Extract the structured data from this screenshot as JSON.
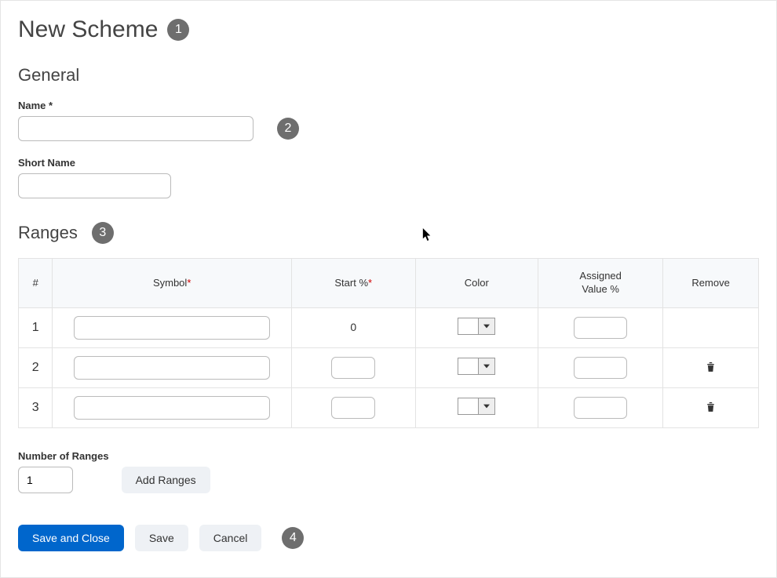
{
  "page_title": "New Scheme",
  "steps": {
    "s1": "1",
    "s2": "2",
    "s3": "3",
    "s4": "4"
  },
  "sections": {
    "general": "General",
    "ranges": "Ranges"
  },
  "fields": {
    "name_label": "Name",
    "name_required": "*",
    "name_value": "",
    "short_name_label": "Short Name",
    "short_name_value": "",
    "num_ranges_label": "Number of Ranges",
    "num_ranges_value": "1"
  },
  "table": {
    "headers": {
      "num": "#",
      "symbol": "Symbol",
      "start": "Start %",
      "color": "Color",
      "assigned": "Assigned\nValue %",
      "remove": "Remove"
    },
    "rows": [
      {
        "num": "1",
        "symbol": "",
        "start_fixed": "0",
        "assigned": "",
        "removable": false
      },
      {
        "num": "2",
        "symbol": "",
        "start": "",
        "assigned": "",
        "removable": true
      },
      {
        "num": "3",
        "symbol": "",
        "start": "",
        "assigned": "",
        "removable": true
      }
    ]
  },
  "buttons": {
    "add_ranges": "Add Ranges",
    "save_and_close": "Save and Close",
    "save": "Save",
    "cancel": "Cancel"
  }
}
